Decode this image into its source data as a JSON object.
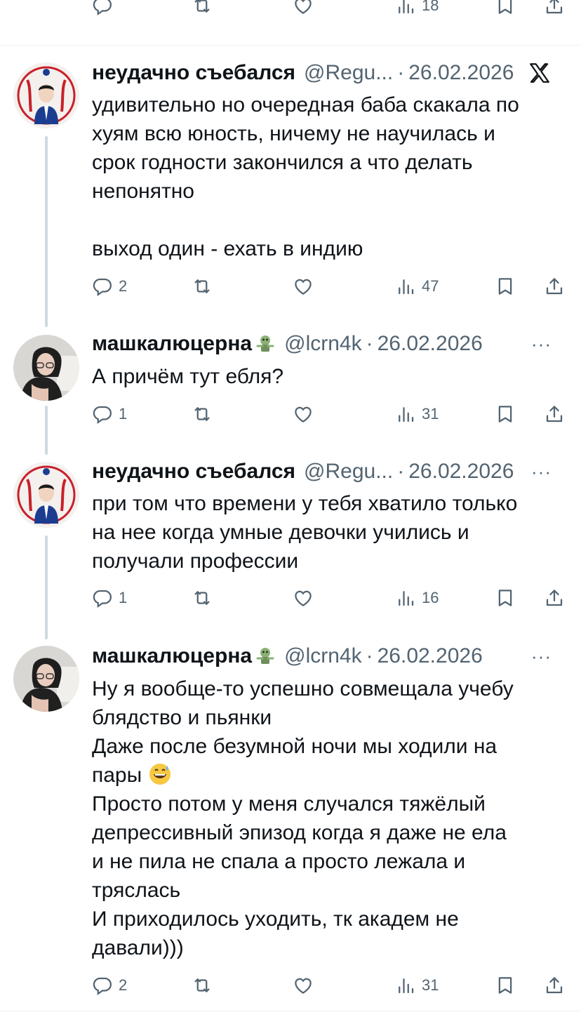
{
  "top_actions": {
    "views": "18"
  },
  "tweets": [
    {
      "name": "неудачно съебался",
      "handle": "@Regu...",
      "date": "26.02.2026",
      "text": "удивительно но очередная баба скакала по\nхуям всю юность, ничему не научилась и\nсрок годности закончился а что делать\nнепонятно\n\nвыход один - ехать в индию",
      "replies": "2",
      "views": "47",
      "corner_icon": "x-logo-icon"
    },
    {
      "name": "машкалюцерна",
      "handle": "@lcrn4k",
      "date": "26.02.2026",
      "text": "А причём тут ебля?",
      "replies": "1",
      "views": "31",
      "corner_icon": "more-icon"
    },
    {
      "name": "неудачно съебался",
      "handle": "@Regu...",
      "date": "26.02.2026",
      "text": "при том что времени у тебя хватило только\nна нее когда умные девочки учились и\nполучали профессии",
      "replies": "1",
      "views": "16",
      "corner_icon": "more-icon"
    },
    {
      "name": "машкалюцерна",
      "handle": "@lcrn4k",
      "date": "26.02.2026",
      "text_part1": "Ну я вообще-то успешно совмещала учебу\nблядство и пьянки\nДаже после безумной ночи мы ходили на\nпары ",
      "text_part2": "\nПросто потом у меня случался тяжёлый\nдепрессивный эпизод когда я даже не ела\nи не пила не спала а просто лежала и\nтряслась\nИ приходилось уходить, тк академ не\nдавали)))",
      "replies": "2",
      "views": "31",
      "corner_icon": "more-icon"
    }
  ],
  "colors": {
    "text": "#0f1419",
    "secondary": "#536471",
    "thread": "#cfd9de",
    "divider": "#eff3f4"
  }
}
